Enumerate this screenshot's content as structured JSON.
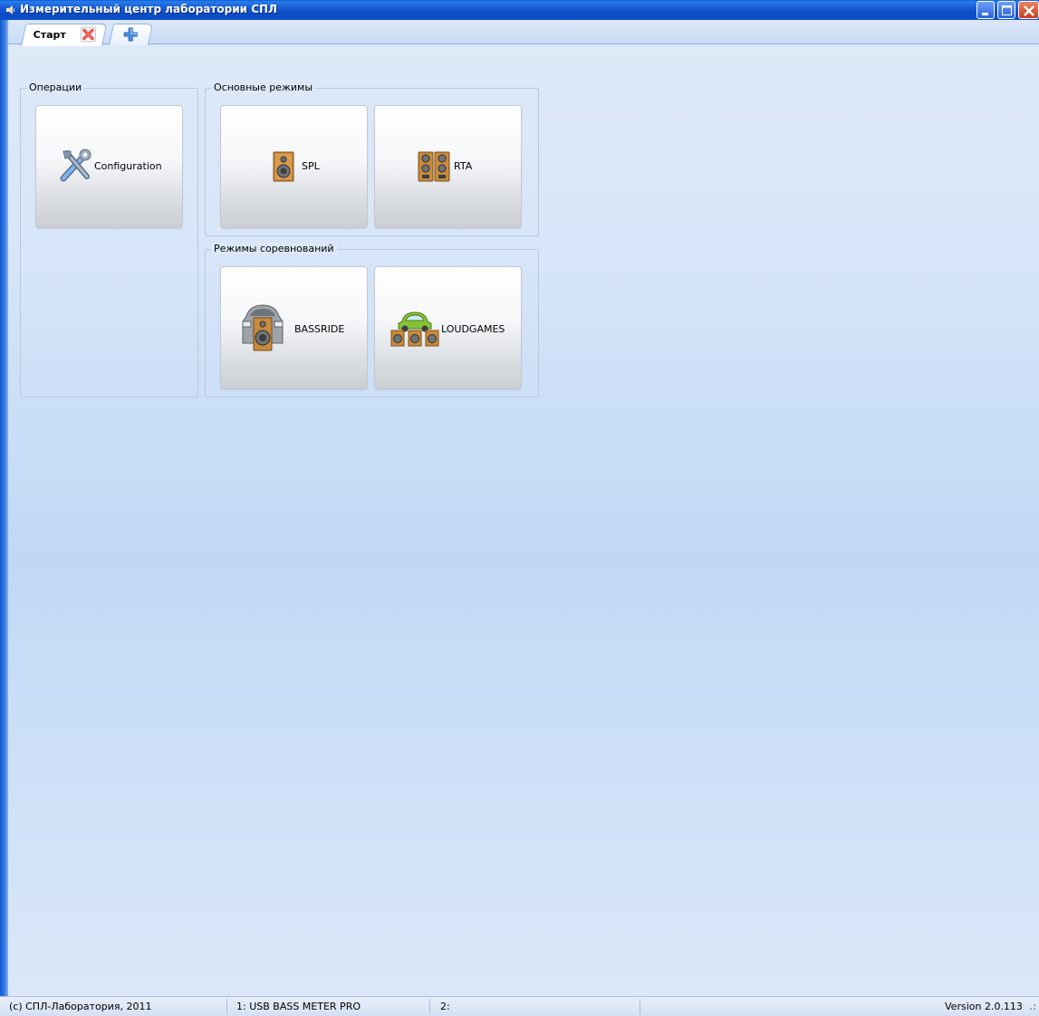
{
  "window": {
    "title": "Измерительный центр лаборатории СПЛ",
    "colors": {
      "titlebar": "#0b4bc4",
      "client_background": "#d6e5f8"
    }
  },
  "tabs": [
    {
      "label": "Старт",
      "icon": "close-icon",
      "active": true
    },
    {
      "label": "",
      "icon": "plus-icon",
      "active": false
    }
  ],
  "groups": {
    "operations": {
      "label": "Операции",
      "tiles": [
        {
          "label": "Configuration",
          "icon": "tools-icon"
        }
      ]
    },
    "main_modes": {
      "label": "Основные режимы",
      "tiles": [
        {
          "label": "SPL",
          "icon": "speaker-icon"
        },
        {
          "label": "RTA",
          "icon": "double-speaker-icon"
        }
      ]
    },
    "competition_modes": {
      "label": "Режимы соревнований",
      "tiles": [
        {
          "label": "BASSRIDE",
          "icon": "car-speaker-icon"
        },
        {
          "label": "LOUDGAMES",
          "icon": "car-speakers-icon"
        }
      ]
    }
  },
  "statusbar": {
    "copyright": "(c) СПЛ-Лаборатория, 2011",
    "device1": "1: USB BASS METER PRO",
    "device2": "2:",
    "version": "Version 2.0.113"
  }
}
